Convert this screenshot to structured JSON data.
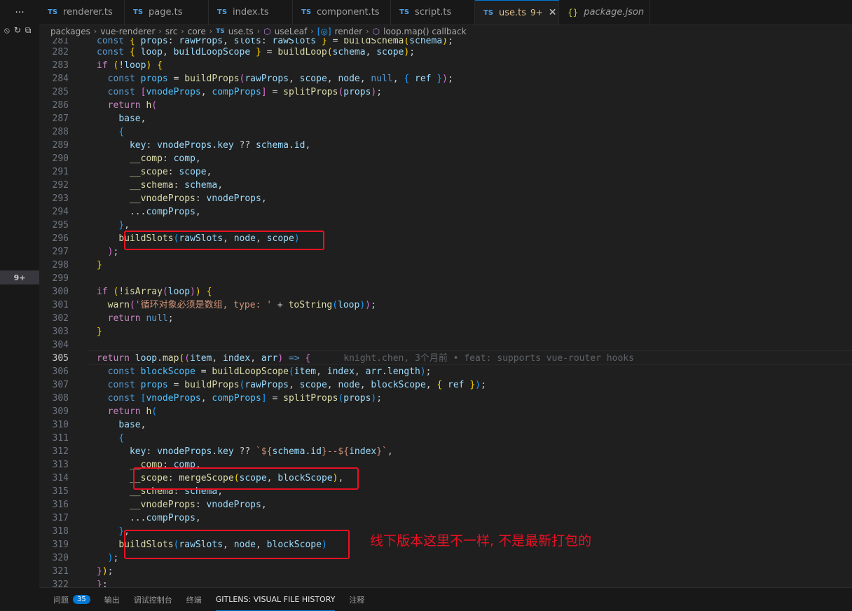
{
  "activity": {
    "menu_glyph": "···",
    "badge": "9+"
  },
  "tabs": [
    {
      "label": "renderer.ts",
      "type": "TS"
    },
    {
      "label": "page.ts",
      "type": "TS"
    },
    {
      "label": "index.ts",
      "type": "TS"
    },
    {
      "label": "component.ts",
      "type": "TS"
    },
    {
      "label": "script.ts",
      "type": "TS"
    },
    {
      "label": "use.ts",
      "type": "TS",
      "modified": "9+",
      "active": true
    },
    {
      "label": "package.json",
      "type": "{}"
    }
  ],
  "breadcrumb": {
    "p1": "packages",
    "p2": "vue-renderer",
    "p3": "src",
    "p4": "core",
    "file": "use.ts",
    "sym1": "useLeaf",
    "sym2": "render",
    "sym3": "loop.map() callback"
  },
  "editor": {
    "current_line": "305",
    "line_numbers": [
      "281",
      "282",
      "283",
      "284",
      "285",
      "286",
      "287",
      "288",
      "289",
      "290",
      "291",
      "292",
      "293",
      "294",
      "295",
      "296",
      "297",
      "298",
      "299",
      "300",
      "301",
      "302",
      "303",
      "304",
      "305",
      "306",
      "307",
      "308",
      "309",
      "310",
      "311",
      "312",
      "313",
      "314",
      "315",
      "316",
      "317",
      "318",
      "319",
      "320",
      "321",
      "322"
    ],
    "blame": "knight.chen, 3个月前 • feat: supports vue-router hooks"
  },
  "annotation": {
    "note": "线下版本这里不一样, 不是最新打包的"
  },
  "panel": {
    "tabs": [
      {
        "label": "问题",
        "badge": "35"
      },
      {
        "label": "输出"
      },
      {
        "label": "调试控制台"
      },
      {
        "label": "终端"
      },
      {
        "label": "GITLENS: VISUAL FILE HISTORY",
        "active": true
      },
      {
        "label": "注释"
      }
    ]
  },
  "colors": {
    "accent": "#0078d4",
    "annotation_red": "#e81123",
    "modified_tab": "#e2c08d"
  }
}
